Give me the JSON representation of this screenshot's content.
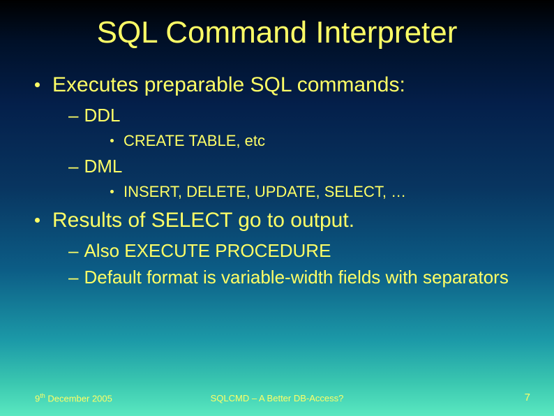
{
  "title": "SQL Command Interpreter",
  "bullets": {
    "b1": "Executes preparable SQL commands:",
    "b1a": "DDL",
    "b1a1": "CREATE TABLE, etc",
    "b1b": "DML",
    "b1b1": "INSERT, DELETE, UPDATE, SELECT, …",
    "b2": "Results of SELECT go to output.",
    "b2a": "Also EXECUTE PROCEDURE",
    "b2b": "Default format is variable-width fields with separators"
  },
  "footer": {
    "date_prefix": "9",
    "date_sup": "th",
    "date_suffix": " December 2005",
    "center": "SQLCMD – A Better DB-Access?",
    "page": "7"
  }
}
